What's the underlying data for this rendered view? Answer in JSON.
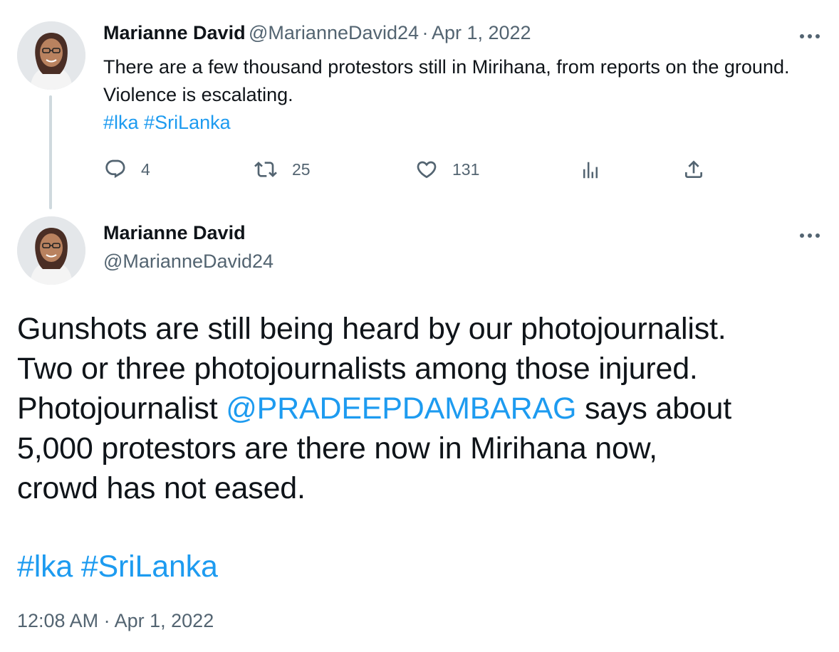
{
  "tweet_parent": {
    "author_name": "Marianne David",
    "handle": "@MarianneDavid24",
    "separator": "·",
    "date": "Apr 1, 2022",
    "text": "There are a few thousand protestors still in Mirihana, from reports on the ground. Violence is escalating.",
    "hashtags": [
      "#lka",
      "#SriLanka"
    ],
    "actions": {
      "replies": "4",
      "retweets": "25",
      "likes": "131"
    },
    "icons": [
      "reply-icon",
      "retweet-icon",
      "like-icon",
      "views-icon",
      "share-icon",
      "more-icon"
    ]
  },
  "tweet_main": {
    "author_name": "Marianne David",
    "handle": "@MarianneDavid24",
    "text_lines": [
      "Gunshots are still being heard by our photojournalist.",
      "Two or three photojournalists among those injured.",
      "Photojournalist ",
      " says about",
      "5,000 protestors are there now in Mirihana now,",
      "crowd has not eased."
    ],
    "mention": "@PRADEEPDAMBARAG",
    "hashtags": [
      "#lka",
      "#SriLanka"
    ],
    "time": "12:08 AM",
    "separator": "·",
    "date": "Apr 1, 2022"
  },
  "colors": {
    "link": "#1d9bf0",
    "muted": "#536471",
    "text": "#0f1419",
    "thread_line": "#cfd9de"
  }
}
